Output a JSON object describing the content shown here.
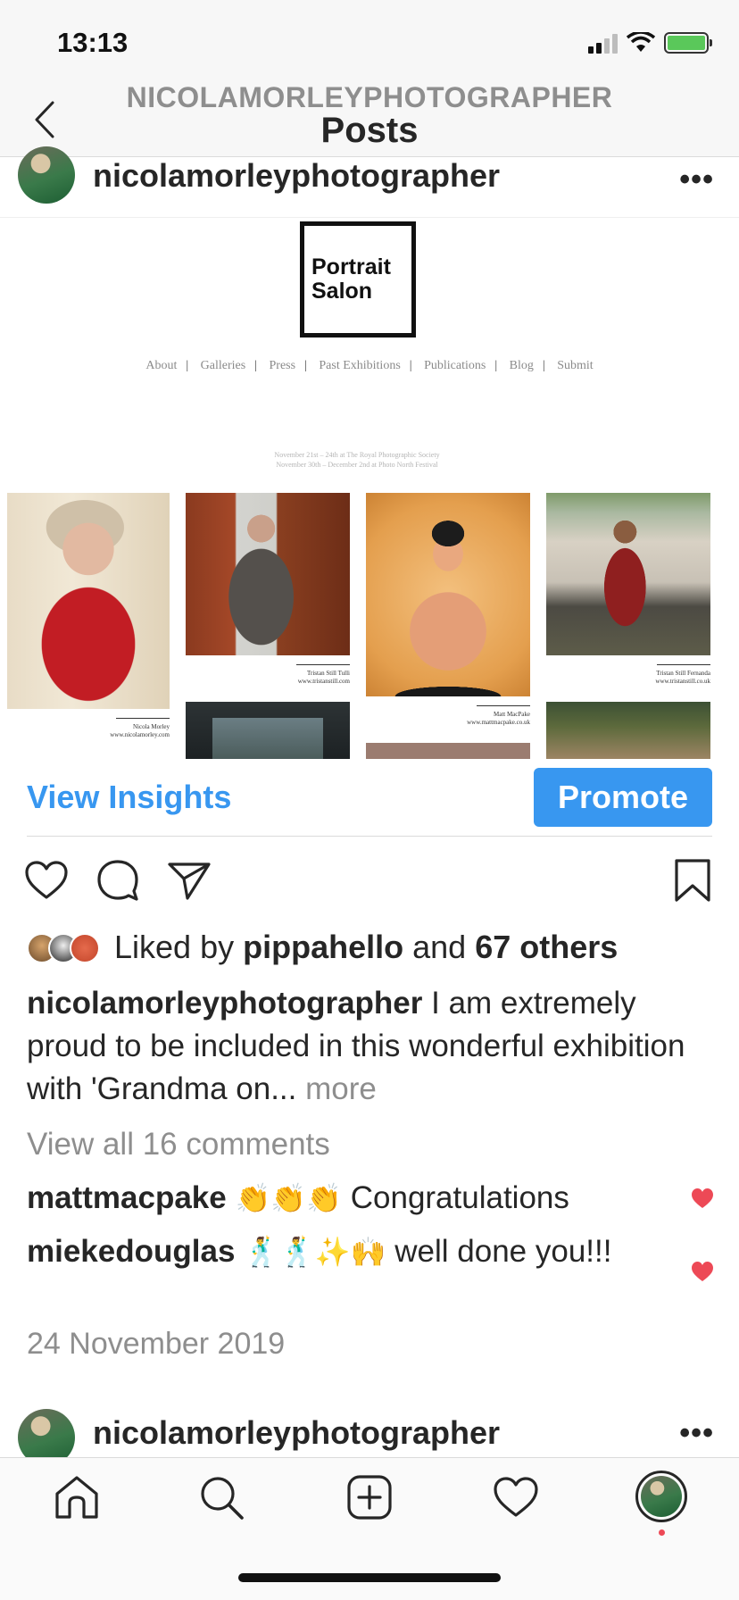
{
  "status_bar": {
    "time": "13:13"
  },
  "header": {
    "username": "NICOLAMORLEYPHOTOGRAPHER",
    "title": "Posts"
  },
  "post": {
    "username": "nicolamorleyphotographer",
    "image": {
      "logo_line1": "Portrait",
      "logo_line2": "Salon",
      "nav": [
        "About",
        "Galleries",
        "Press",
        "Past Exhibitions",
        "Publications",
        "Blog",
        "Submit"
      ],
      "dates_line1": "November 21st – 24th at The Royal Photographic Society",
      "dates_line2": "November 30th – December 2nd at Photo North Festival",
      "captions": [
        {
          "name": "Nicola Morley",
          "url": "www.nicolamorley.com"
        },
        {
          "name": "Tristan Still Tulli",
          "url": "www.tristanstill.com"
        },
        {
          "name": "Matt MacPake",
          "url": "www.mattmacpake.co.uk"
        },
        {
          "name": "Tristan Still Fernanda",
          "url": "www.tristanstill.co.uk"
        }
      ]
    },
    "view_insights": "View Insights",
    "promote": "Promote",
    "likes": {
      "prefix": "Liked by",
      "user": "pippahello",
      "and": "and",
      "others": "67 others"
    },
    "caption": {
      "username": "nicolamorleyphotographer",
      "text": "I am extremely proud to be included in this wonderful exhibition with 'Grandma on...",
      "more": "more"
    },
    "view_comments": "View all 16 comments",
    "comments": [
      {
        "user": "mattmacpake",
        "emoji": "👏👏👏",
        "text": "Congratulations"
      },
      {
        "user": "miekedouglas",
        "emoji": "🕺🕺✨🙌",
        "text": "well done you!!!"
      }
    ],
    "date": "24 November 2019"
  },
  "next_post": {
    "username": "nicolamorleyphotographer"
  },
  "colors": {
    "accent": "#3897f0",
    "heart": "#ed4956",
    "muted": "#8e8e8e"
  }
}
